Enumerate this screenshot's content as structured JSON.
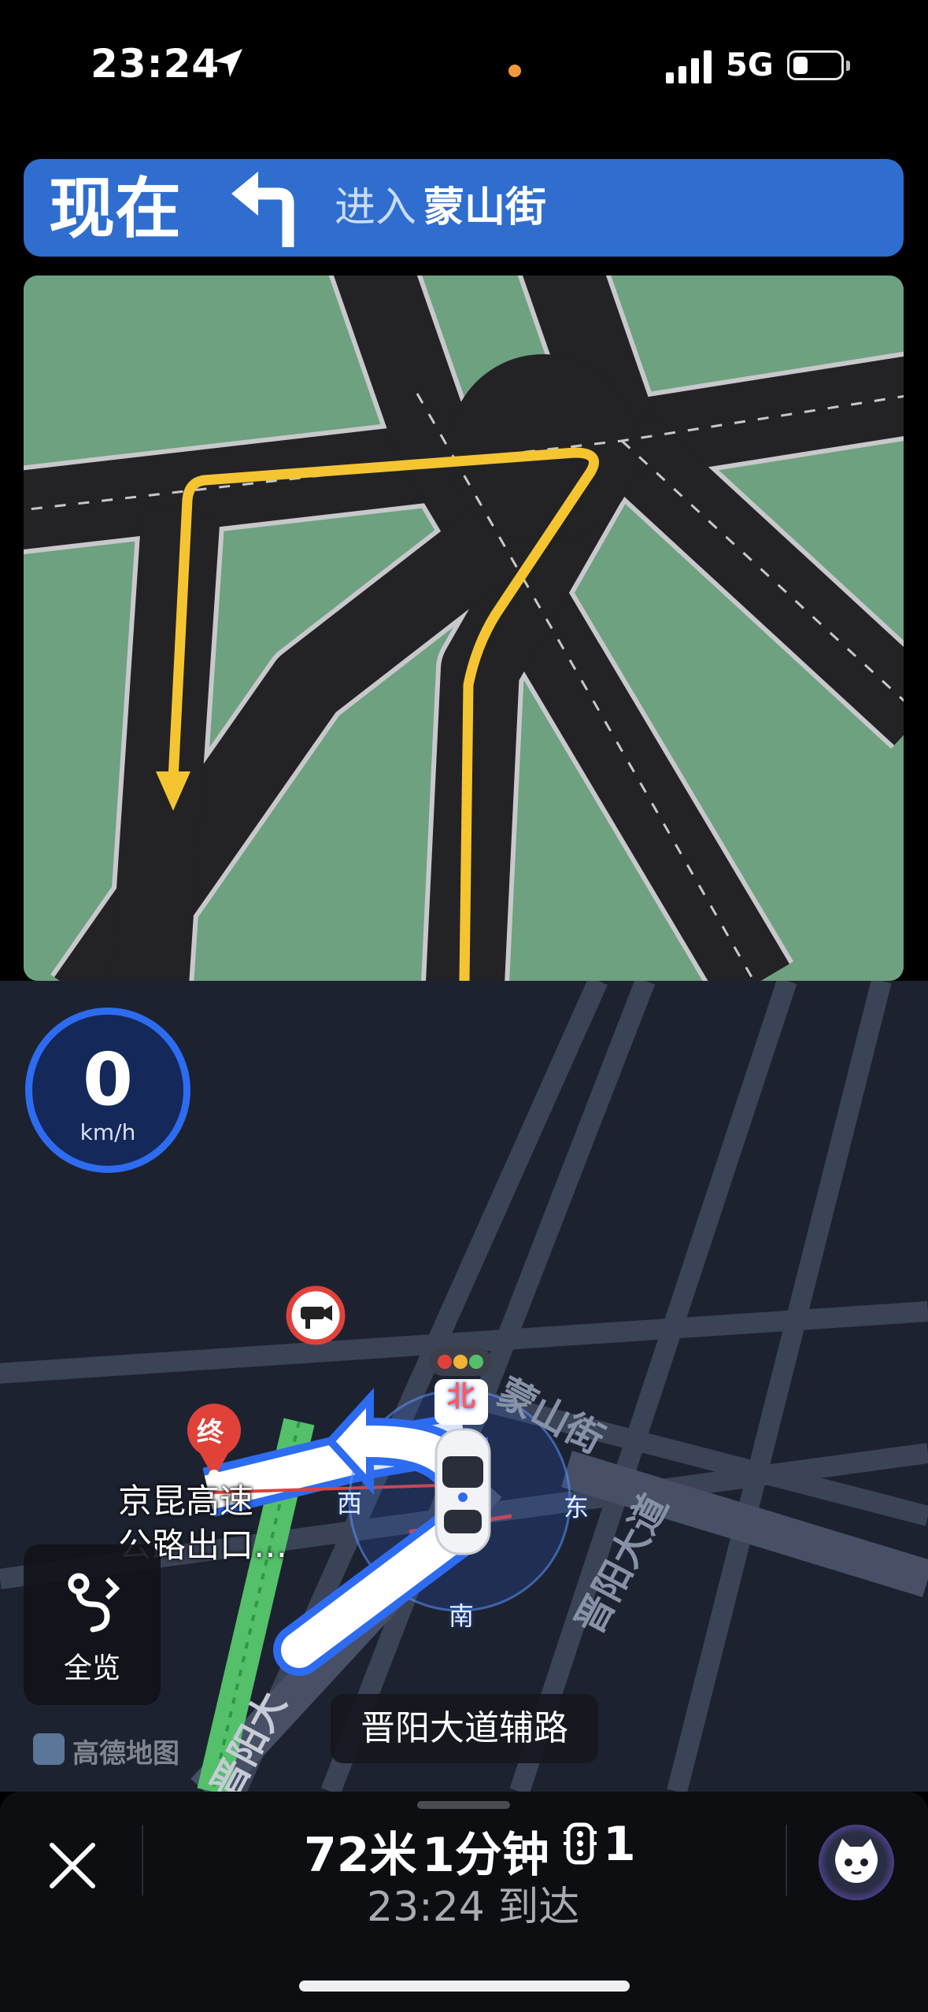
{
  "status_bar": {
    "time": "23:24",
    "network": "5G",
    "icons": {
      "location": "location-arrow-icon",
      "signal": "signal-bars-icon",
      "battery": "battery-icon"
    },
    "colors": {
      "mic_indicator": "#f29a38"
    }
  },
  "guidance": {
    "when": "现在",
    "turn_icon": "turn-left-icon",
    "action": "进入",
    "road": "蒙山街",
    "colors": {
      "banner": "#2f6ecf"
    }
  },
  "junction_view": {
    "colors": {
      "grass": "#6ea17f",
      "road": "#232325",
      "route": "#f5c531"
    }
  },
  "map": {
    "speed": {
      "value": "0",
      "unit": "km/h"
    },
    "overview": {
      "label": "全览",
      "icon": "route-overview-icon"
    },
    "logo": "高德地图",
    "current_road": "晋阳大道辅路",
    "poi": {
      "marker": "终",
      "label_line1": "京昆高速",
      "label_line2": "公路出口…"
    },
    "compass": {
      "north": "北",
      "west": "西",
      "east": "东",
      "south": "南"
    },
    "streets": {
      "mengshan": "蒙山街",
      "jinyang": "晋阳大道",
      "jinyang_left": "晋阳大"
    },
    "icons": {
      "camera": "speed-camera-icon",
      "traffic_light": "traffic-light-icon",
      "car": "car-icon"
    },
    "colors": {
      "route": "#2d6cf0",
      "destination": "#e0423a",
      "passed_route": "#54c06a"
    }
  },
  "trip": {
    "distance": "72米",
    "duration": "1分钟",
    "traffic_lights": "1",
    "arrival": "23:24 到达",
    "close_icon": "close-icon",
    "traffic_light_icon": "traffic-light-icon",
    "assistant_icon": "voice-assistant-icon"
  }
}
